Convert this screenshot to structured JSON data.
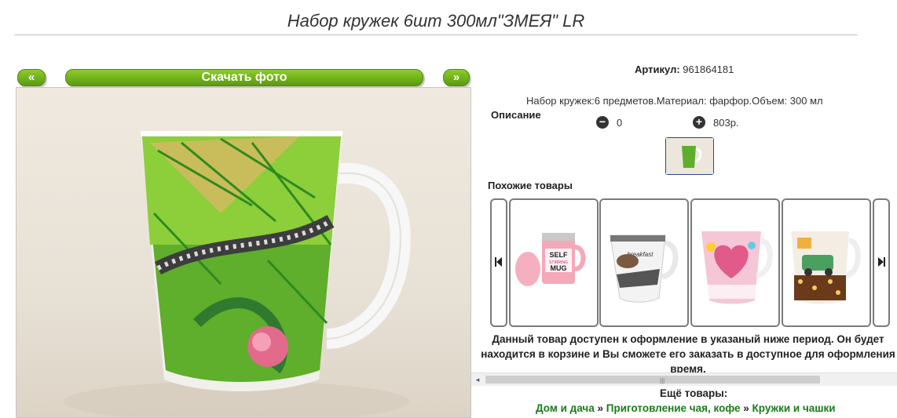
{
  "product": {
    "title": "Набор кружек 6шт 300мл\"ЗМЕЯ\" LR",
    "article_label": "Артикул:",
    "article_value": "961864181",
    "description_text": "Набор кружек:6 предметов.Материал: фарфор.Объем: 300 мл",
    "description_label": "Описание",
    "quantity": "0",
    "price": "803р."
  },
  "gallery": {
    "prev_label": "«",
    "download_label": "Скачать фото",
    "next_label": "»"
  },
  "similar": {
    "label": "Похожие товары",
    "items": [
      {
        "name": "self-stirring-mug",
        "mug_text_1": "SELF",
        "mug_text_2": "STIRRING",
        "mug_text_3": "MUG"
      },
      {
        "name": "breakfast-mug",
        "mug_text_1": "breakfast"
      },
      {
        "name": "pink-heart-mug"
      },
      {
        "name": "retro-car-mug"
      }
    ]
  },
  "notice": "Данный товар доступен к оформление в указаный ниже период. Он будет находится в корзине и Вы сможете его заказать в доступное для оформления время.",
  "more": {
    "label": "Ещё товары:",
    "crumb_1": "Дом и дача",
    "crumb_2": "Приготовление чая, кофе",
    "crumb_3": "Кружки и чашки",
    "separator": "»"
  },
  "colors": {
    "accent_green": "#6aaa1a",
    "link_green": "#1a7a1a"
  }
}
